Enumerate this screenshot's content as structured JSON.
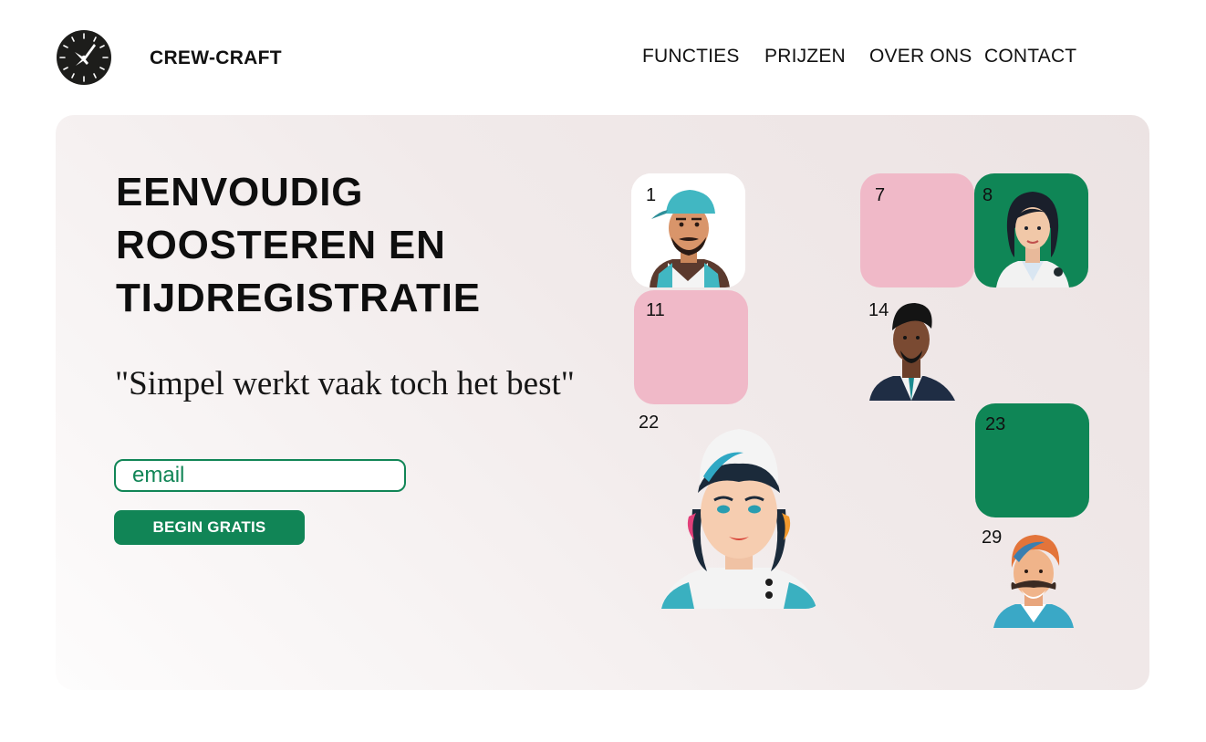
{
  "brand": {
    "name": "CREW-CRAFT",
    "logo_icon": "clock-icon"
  },
  "nav": [
    {
      "label": "FUNCTIES"
    },
    {
      "label": "PRIJZEN"
    },
    {
      "label": "OVER ONS"
    },
    {
      "label": "CONTACT"
    }
  ],
  "hero": {
    "headline": [
      "EENVOUDIG",
      "ROOSTEREN EN",
      "TIJDREGISTRATIE"
    ],
    "quote": "\"Simpel werkt vaak toch het best\"",
    "email": {
      "placeholder": "email",
      "value": ""
    },
    "cta_label": "BEGIN GRATIS"
  },
  "calendar": {
    "days": [
      "1",
      "7",
      "8",
      "11",
      "14",
      "22",
      "23",
      "29"
    ]
  },
  "colors": {
    "accent": "#118556",
    "tile_pink": "#f0b9c8",
    "tile_green": "#0f8656",
    "hero_bg": "#f1eaea"
  }
}
